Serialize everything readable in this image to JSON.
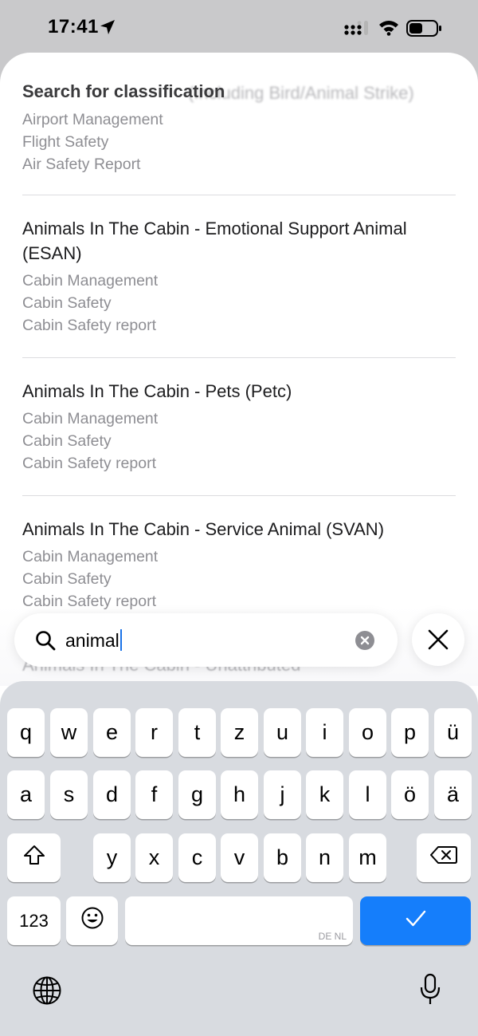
{
  "status_bar": {
    "time": "17:41",
    "icons": [
      "location-arrow-icon",
      "cellular-signal-icon",
      "wifi-icon",
      "battery-icon"
    ]
  },
  "sheet": {
    "title": "Search for classification",
    "title_overlap_text": "(Including Bird/Animal Strike)",
    "first_result_meta": [
      "Airport Management",
      "Flight Safety",
      "Air Safety Report"
    ],
    "results": [
      {
        "title_line1": "Animals In The Cabin - Emotional Support Animal",
        "title_line2": "(ESAN)",
        "meta": [
          "Cabin Management",
          "Cabin Safety",
          "Cabin Safety report"
        ]
      },
      {
        "title_line1": "Animals In The Cabin - Pets (Petc)",
        "meta": [
          "Cabin Management",
          "Cabin Safety",
          "Cabin Safety report"
        ]
      },
      {
        "title_line1": "Animals In The Cabin - Service Animal (SVAN)",
        "meta": [
          "Cabin Management",
          "Cabin Safety",
          "Cabin Safety report"
        ]
      }
    ],
    "partial_result_title": "Animals In The Cabin - Unattributed"
  },
  "search": {
    "value": "animal",
    "icons": [
      "search-icon",
      "clear-icon",
      "close-icon"
    ]
  },
  "keyboard": {
    "row1": [
      "q",
      "w",
      "e",
      "r",
      "t",
      "z",
      "u",
      "i",
      "o",
      "p",
      "ü"
    ],
    "row2": [
      "a",
      "s",
      "d",
      "f",
      "g",
      "h",
      "j",
      "k",
      "l",
      "ö",
      "ä"
    ],
    "row3": [
      "y",
      "x",
      "c",
      "v",
      "b",
      "n",
      "m"
    ],
    "numbers_label": "123",
    "space_hint": "DE NL",
    "accent_color": "#157efb"
  }
}
